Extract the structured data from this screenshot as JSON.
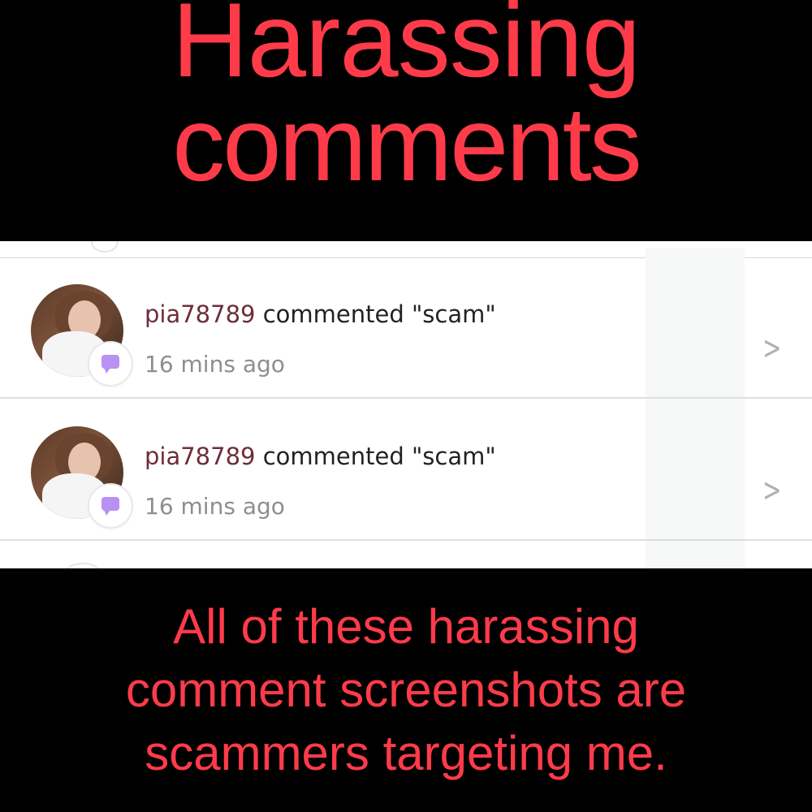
{
  "title": {
    "line1": "Harassing",
    "line2": "comments"
  },
  "notifications": [
    {
      "username": "pia78789",
      "action": " commented \"scam\"",
      "time": "16 mins ago",
      "badge_icon": "comment-bubble-icon"
    },
    {
      "username": "pia78789",
      "action": " commented \"scam\"",
      "time": "16 mins ago",
      "badge_icon": "comment-bubble-icon"
    }
  ],
  "caption": {
    "line1": "All of these harassing",
    "line2": "comment screenshots are",
    "line3": "scammers targeting me."
  },
  "colors": {
    "text_accent": "#ff3b4a",
    "username": "#6d2d3c",
    "badge": "#b892f2",
    "background": "#000000"
  }
}
